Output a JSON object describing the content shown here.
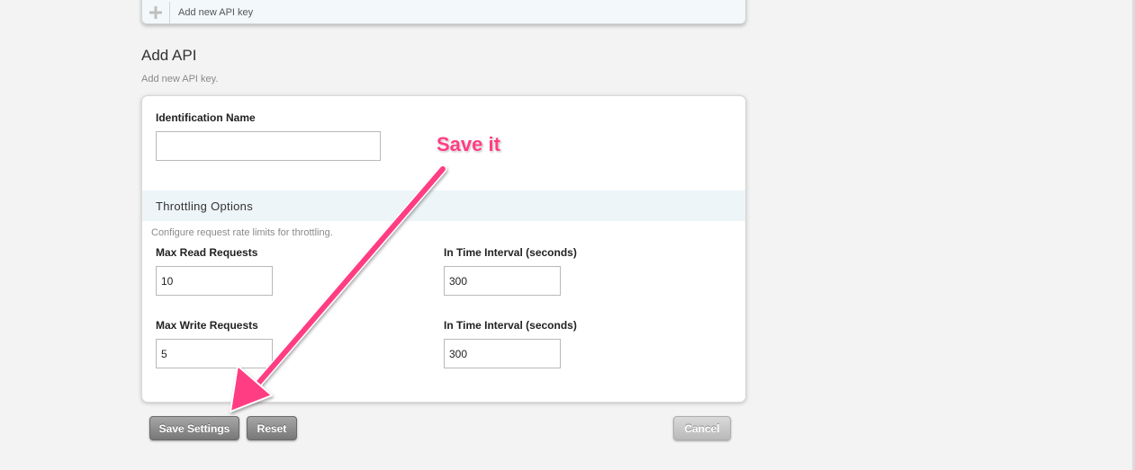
{
  "top_card": {
    "add_key_label": "Add new API key"
  },
  "section": {
    "title": "Add API",
    "description": "Add new API key."
  },
  "form": {
    "identification": {
      "label": "Identification Name",
      "value": ""
    },
    "throttling": {
      "title": "Throttling Options",
      "description": "Configure request rate limits for throttling.",
      "max_read": {
        "label": "Max Read Requests",
        "value": "10"
      },
      "read_interval": {
        "label": "In Time Interval (seconds)",
        "value": "300"
      },
      "max_write": {
        "label": "Max Write Requests",
        "value": "5"
      },
      "write_interval": {
        "label": "In Time Interval (seconds)",
        "value": "300"
      }
    }
  },
  "buttons": {
    "save": "Save Settings",
    "reset": "Reset",
    "cancel": "Cancel"
  },
  "annotation": {
    "text": "Save it",
    "color": "#ff3d82"
  },
  "colors": {
    "background": "#f3f3f3",
    "band": "#eef5f8",
    "button_dark": "#8a8a8a",
    "button_light": "#c8c8c8"
  },
  "icons": {
    "add": "plus-icon",
    "annotation": "arrow-icon"
  }
}
